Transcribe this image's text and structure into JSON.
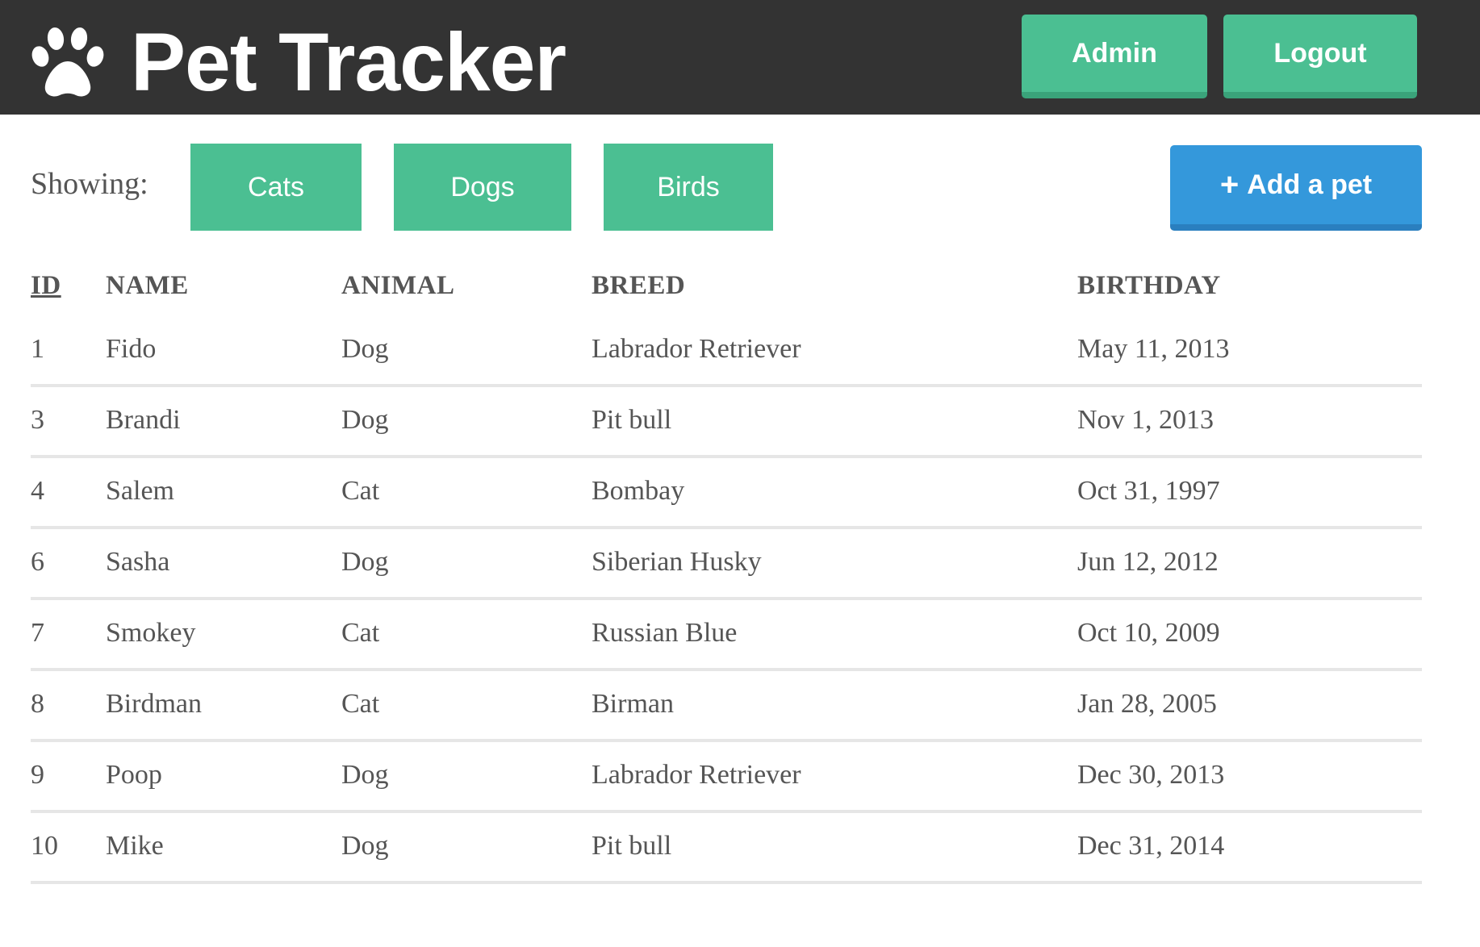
{
  "header": {
    "title": "Pet Tracker",
    "logo_icon": "paw-icon",
    "admin_label": "Admin",
    "logout_label": "Logout"
  },
  "filters": {
    "label": "Showing:",
    "options": [
      "Cats",
      "Dogs",
      "Birds"
    ]
  },
  "add_button": {
    "icon": "plus-icon",
    "icon_glyph": "+",
    "label": "Add a pet"
  },
  "table": {
    "columns": [
      "ID",
      "NAME",
      "ANIMAL",
      "BREED",
      "BIRTHDAY"
    ],
    "sorted_column": "ID",
    "rows": [
      {
        "id": "1",
        "name": "Fido",
        "animal": "Dog",
        "breed": "Labrador Retriever",
        "birthday": "May 11, 2013"
      },
      {
        "id": "3",
        "name": "Brandi",
        "animal": "Dog",
        "breed": "Pit bull",
        "birthday": "Nov 1, 2013"
      },
      {
        "id": "4",
        "name": "Salem",
        "animal": "Cat",
        "breed": "Bombay",
        "birthday": "Oct 31, 1997"
      },
      {
        "id": "6",
        "name": "Sasha",
        "animal": "Dog",
        "breed": "Siberian Husky",
        "birthday": "Jun 12, 2012"
      },
      {
        "id": "7",
        "name": "Smokey",
        "animal": "Cat",
        "breed": "Russian Blue",
        "birthday": "Oct 10, 2009"
      },
      {
        "id": "8",
        "name": "Birdman",
        "animal": "Cat",
        "breed": "Birman",
        "birthday": "Jan 28, 2005"
      },
      {
        "id": "9",
        "name": "Poop",
        "animal": "Dog",
        "breed": "Labrador Retriever",
        "birthday": "Dec 30, 2013"
      },
      {
        "id": "10",
        "name": "Mike",
        "animal": "Dog",
        "breed": "Pit bull",
        "birthday": "Dec 31, 2014"
      }
    ]
  },
  "colors": {
    "header_bg": "#333333",
    "green_button": "#4bbf92",
    "blue_button": "#3498db",
    "text": "#555555",
    "row_divider": "#e6e6e6"
  }
}
